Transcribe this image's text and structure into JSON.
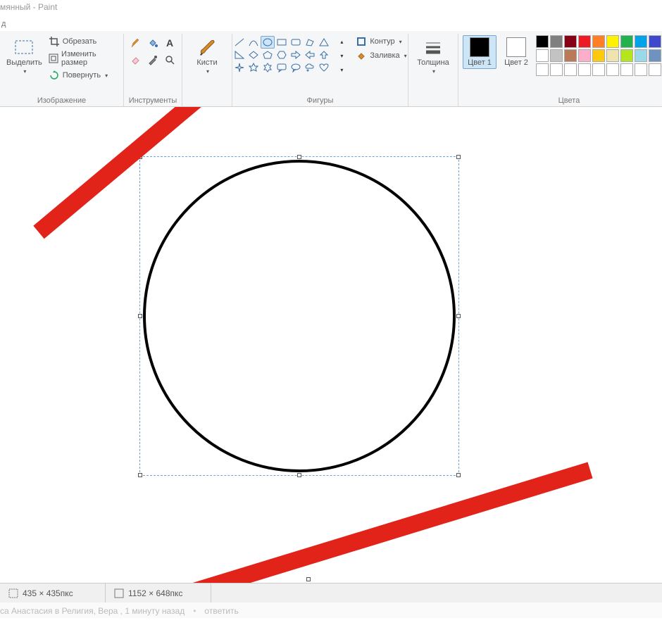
{
  "window": {
    "title": "мянный - Paint"
  },
  "tab_letter": "д",
  "ribbon": {
    "image_group": {
      "label": "Изображение",
      "select": "Выделить",
      "crop": "Обрезать",
      "resize": "Изменить размер",
      "rotate": "Повернуть"
    },
    "tools_group": {
      "label": "Инструменты"
    },
    "brushes_group": {
      "label": "Кисти"
    },
    "shapes_group": {
      "label": "Фигуры",
      "outline": "Контур",
      "fill": "Заливка"
    },
    "size_group": {
      "label": "Толщина"
    },
    "colors_group": {
      "label": "Цвета",
      "color1": "Цвет 1",
      "color2": "Цвет 2",
      "palette_row1": [
        "#000000",
        "#7f7f7f",
        "#880015",
        "#ed1c24",
        "#ff7f27",
        "#fff200",
        "#22b14c",
        "#00a2e8",
        "#3f48cc",
        "#a349a4"
      ],
      "palette_row2": [
        "#ffffff",
        "#c3c3c3",
        "#b97a57",
        "#ffaec9",
        "#ffc90e",
        "#efe4b0",
        "#b5e61d",
        "#99d9ea",
        "#7092be",
        "#c8bfe7"
      ],
      "palette_row3": [
        "",
        "",
        "",
        "",
        "",
        "",
        "",
        "",
        "",
        ""
      ]
    }
  },
  "status": {
    "selection": "435 × 435пкс",
    "canvas": "1152 × 648пкс"
  },
  "footer": {
    "text1": "са Анастасия в  Религия, Вера , 1 минуту назад",
    "reply": "ответить"
  }
}
